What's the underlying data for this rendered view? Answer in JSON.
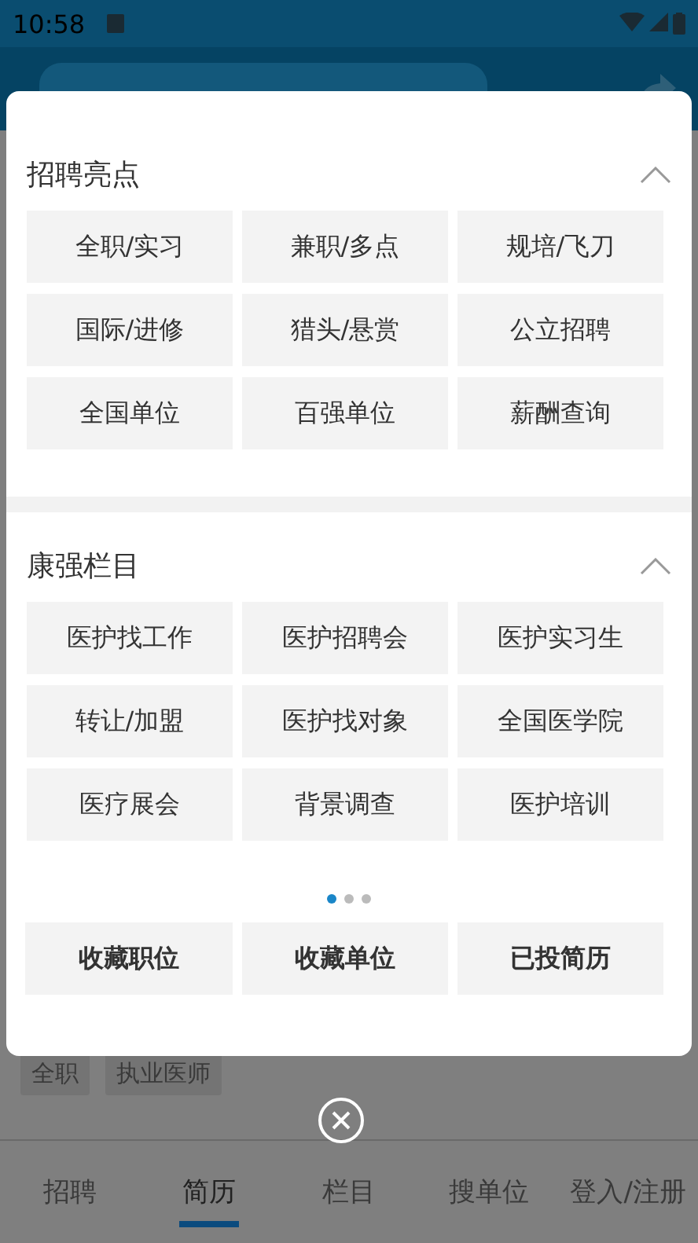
{
  "status_bar": {
    "time": "10:58"
  },
  "sections": [
    {
      "title": "招聘亮点",
      "expanded": true,
      "items": [
        "全职/实习",
        "兼职/多点",
        "规培/飞刀",
        "国际/进修",
        "猎头/悬赏",
        "公立招聘",
        "全国单位",
        "百强单位",
        "薪酬查询"
      ]
    },
    {
      "title": "康强栏目",
      "expanded": true,
      "items": [
        "医护找工作",
        "医护招聘会",
        "医护实习生",
        "转让/加盟",
        "医护找对象",
        "全国医学院",
        "医疗展会",
        "背景调查",
        "医护培训"
      ]
    }
  ],
  "pager": [
    {
      "selected": true
    },
    {
      "selected": false
    },
    {
      "selected": false
    }
  ],
  "quick_buttons": [
    "收藏职位",
    "收藏单位",
    "已投简历"
  ],
  "job_tags": [
    "全职",
    "执业医师"
  ],
  "bottom_nav": [
    {
      "label": "招聘",
      "selected": false
    },
    {
      "label": "简历",
      "selected": true
    },
    {
      "label": "栏目",
      "selected": false
    },
    {
      "label": "搜单位",
      "selected": false
    },
    {
      "label": "登入/注册",
      "selected": false
    }
  ]
}
